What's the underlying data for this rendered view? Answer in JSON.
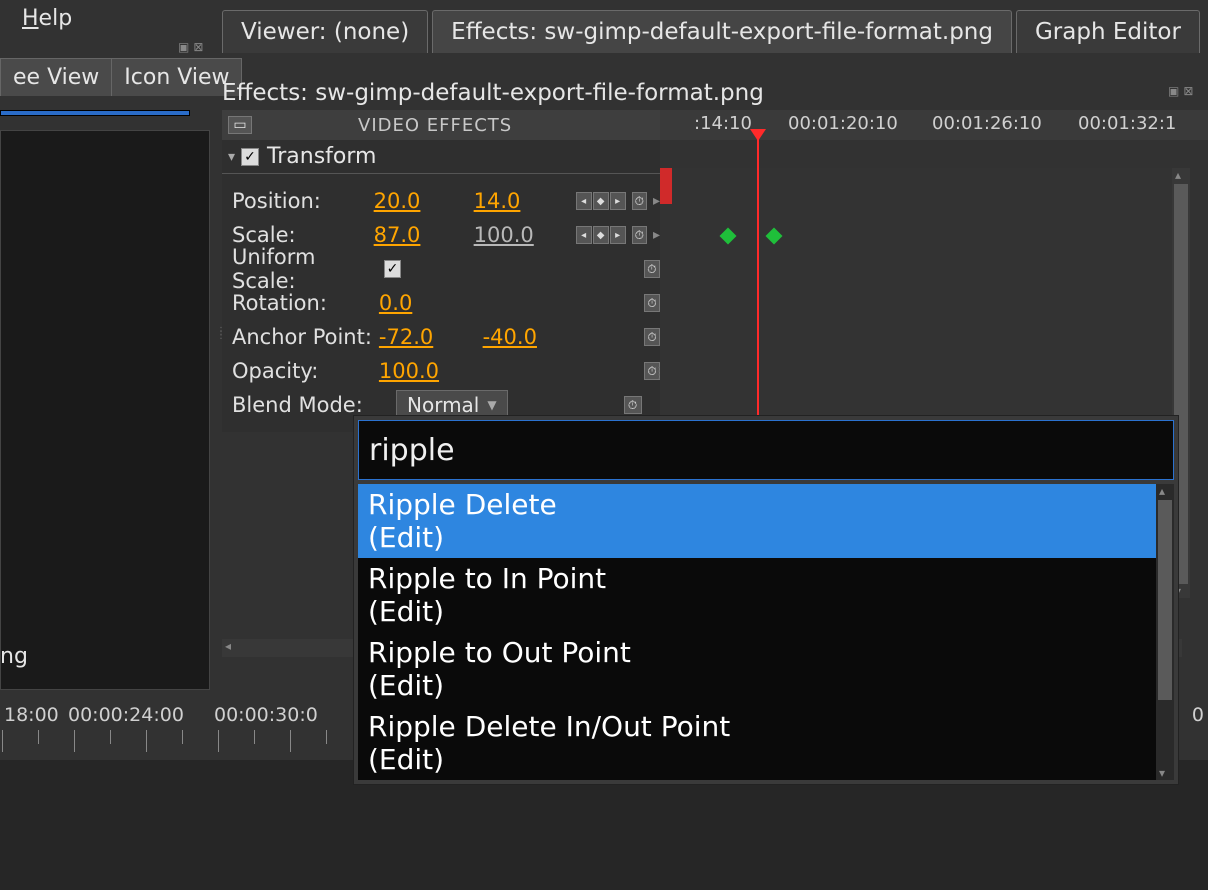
{
  "menubar": {
    "help_label": "Help",
    "help_mnemonic": "H"
  },
  "left_panel": {
    "tabs": [
      {
        "label": "ee View"
      },
      {
        "label": "Icon View"
      }
    ],
    "footer_text": "ng"
  },
  "main_tabs": [
    {
      "label": "Viewer: (none)",
      "active": false
    },
    {
      "label": "Effects: sw-gimp-default-export-file-format.png",
      "active": true
    },
    {
      "label": "Graph Editor",
      "active": false
    }
  ],
  "effects": {
    "title": "Effects: sw-gimp-default-export-file-format.png",
    "header": "VIDEO EFFECTS",
    "transform": {
      "label": "Transform",
      "checked": true,
      "rows": {
        "position": {
          "label": "Position:",
          "x": "20.0",
          "y": "14.0"
        },
        "scale": {
          "label": "Scale:",
          "x": "87.0",
          "y": "100.0"
        },
        "uniform_scale": {
          "label": "Uniform Scale:",
          "checked": true
        },
        "rotation": {
          "label": "Rotation:",
          "x": "0.0"
        },
        "anchor": {
          "label": "Anchor Point:",
          "x": "-72.0",
          "y": "-40.0"
        },
        "opacity": {
          "label": "Opacity:",
          "x": "100.0"
        },
        "blend": {
          "label": "Blend Mode:",
          "value": "Normal"
        }
      }
    }
  },
  "ruler": {
    "timecodes": [
      ":14:10",
      "00:01:20:10",
      "00:01:26:10",
      "00:01:32:1"
    ]
  },
  "timeline_ruler": {
    "timecodes": [
      "18:00",
      "00:00:24:00",
      "00:00:30:0"
    ],
    "right_label": "0"
  },
  "palette": {
    "query": "ripple",
    "items": [
      {
        "label": "Ripple Delete",
        "sub": "(Edit)",
        "selected": true
      },
      {
        "label": "Ripple to In Point",
        "sub": "(Edit)",
        "selected": false
      },
      {
        "label": "Ripple to Out Point",
        "sub": "(Edit)",
        "selected": false
      },
      {
        "label": "Ripple Delete In/Out Point",
        "sub": "(Edit)",
        "selected": false
      }
    ]
  }
}
